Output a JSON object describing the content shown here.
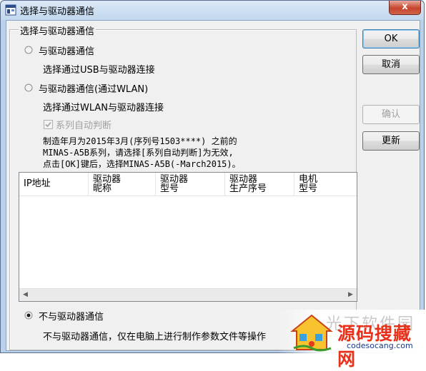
{
  "window": {
    "title": "选择与驱动器通信",
    "close_glyph": "x"
  },
  "group": {
    "legend": "选择与驱动器通信"
  },
  "options": [
    {
      "label": "与驱动器通信",
      "desc": "选择通过USB与驱动器连接",
      "selected": false
    },
    {
      "label": "与驱动器通信(通过WLAN)",
      "desc": "选择通过WLAN与驱动器连接",
      "selected": false
    }
  ],
  "auto_detect": {
    "label": "系列自动判断",
    "checked": true,
    "enabled": false
  },
  "note_lines": [
    "制造年月为2015年3月(序列号1503****) 之前的",
    "MINAS-A5B系列，请选择[系列自动判断]为无效,",
    "点击[OK]键后，选择MINAS-A5B(-March2015)。"
  ],
  "device_list": {
    "columns": [
      {
        "line1": "IP地址",
        "line2": ""
      },
      {
        "line1": "驱动器",
        "line2": "昵称"
      },
      {
        "line1": "驱动器",
        "line2": "型号"
      },
      {
        "line1": "驱动器",
        "line2": "生产序号"
      },
      {
        "line1": "电机",
        "line2": "型号"
      }
    ],
    "rows": []
  },
  "offline_option": {
    "label": "不与驱动器通信",
    "desc": "不与驱动器通信，仅在电脑上进行制作参数文件等操作",
    "selected": true
  },
  "buttons": {
    "ok": "OK",
    "cancel": "取消",
    "confirm": "确认",
    "refresh": "更新"
  },
  "watermark": {
    "brand": "源码搜藏网",
    "url": "codesocang.com",
    "faded": "光下软件园"
  }
}
